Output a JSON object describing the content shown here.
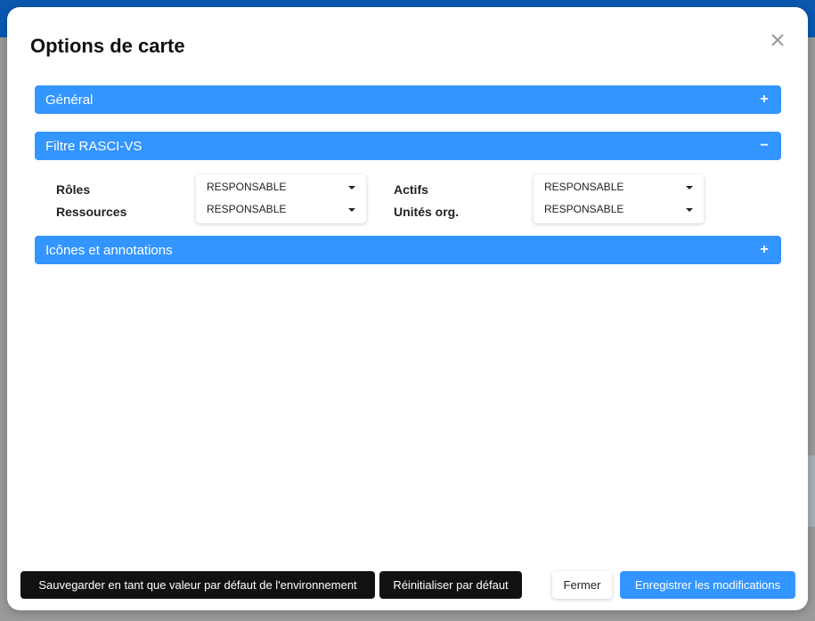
{
  "modal": {
    "title": "Options de carte",
    "close_icon": "close-icon"
  },
  "sections": {
    "general": {
      "label": "Général",
      "toggle": "+"
    },
    "rasci": {
      "label": "Filtre RASCI-VS",
      "toggle": "−"
    },
    "icons": {
      "label": "Icônes et annotations",
      "toggle": "+"
    }
  },
  "filters": {
    "roles": {
      "label": "Rôles",
      "value": "RESPONSABLE"
    },
    "ressources": {
      "label": "Ressources",
      "value": "RESPONSABLE"
    },
    "actifs": {
      "label": "Actifs",
      "value": "RESPONSABLE"
    },
    "unites": {
      "label": "Unités org.",
      "value": "RESPONSABLE"
    }
  },
  "footer": {
    "save_default": "Sauvegarder en tant que valeur par défaut de l'environnement",
    "reset_default": "Réinitialiser par défaut",
    "close": "Fermer",
    "save_changes": "Enregistrer les modifications"
  },
  "colors": {
    "accent": "#3395ff",
    "dark_button": "#111111",
    "topbar": "#0a58b0"
  }
}
